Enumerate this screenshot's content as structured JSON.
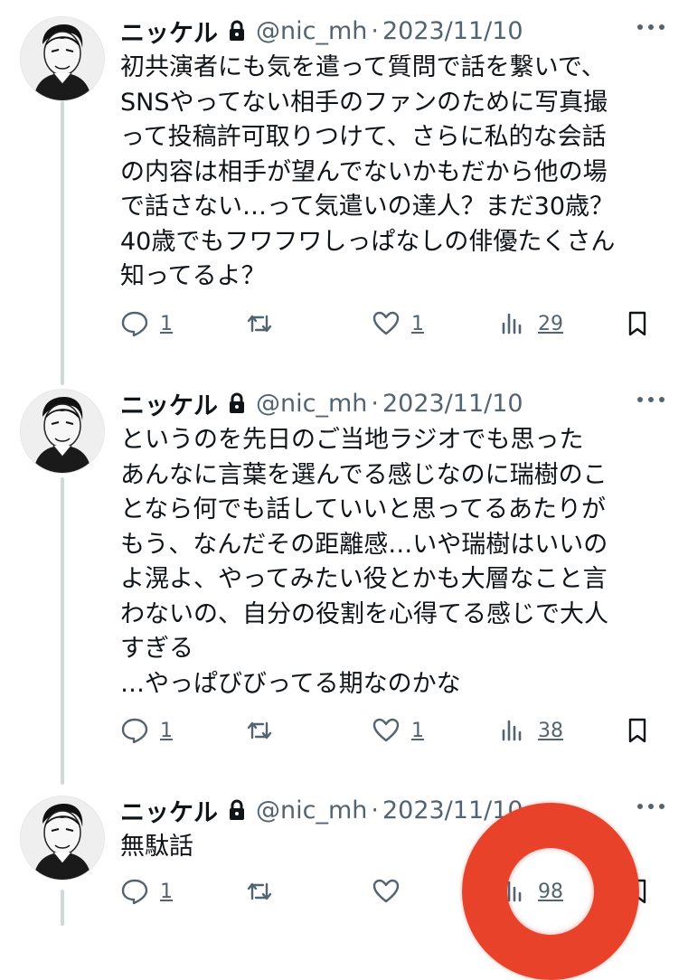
{
  "tweets": [
    {
      "author": {
        "name": "ニッケル",
        "handle": "@nic_mh"
      },
      "separator": "·",
      "date": "2023/11/10",
      "text": "初共演者にも気を遣って質問で話を繋いで、\nSNSやってない相手のファンのために写真撮\nって投稿許可取りつけて、さらに私的な会話\nの内容は相手が望んでないかもだから他の場\nで話さない…って気遣いの達人？まだ30歳？\n40歳でもフワフワしっぱなしの俳優たくさん\n知ってるよ？",
      "replies": "1",
      "retweets": "",
      "likes": "1",
      "views": "29"
    },
    {
      "author": {
        "name": "ニッケル",
        "handle": "@nic_mh"
      },
      "separator": "·",
      "date": "2023/11/10",
      "text": "というのを先日のご当地ラジオでも思った\nあんなに言葉を選んでる感じなのに瑞樹のこ\nとなら何でも話していいと思ってるあたりが\nもう、なんだその距離感…いや瑞樹はいいの\nよ滉よ、やってみたい役とかも大層なこと言\nわないの、自分の役割を心得てる感じで大人\nすぎる\n…やっぱびびってる期なのかな",
      "replies": "1",
      "retweets": "",
      "likes": "1",
      "views": "38"
    },
    {
      "author": {
        "name": "ニッケル",
        "handle": "@nic_mh"
      },
      "separator": "·",
      "date": "2023/11/10",
      "text": "無駄話",
      "replies": "1",
      "retweets": "",
      "likes": "",
      "views": "98"
    }
  ],
  "icons": {
    "reply": "speech-bubble-icon",
    "retweet": "retweet-arrows-icon",
    "like": "heart-icon",
    "views": "bar-chart-icon",
    "bookmark": "bookmark-icon",
    "more": "ellipsis-icon",
    "lock": "lock-icon"
  },
  "colors": {
    "text": "#0f1419",
    "muted": "#536471",
    "thread": "#cfd9de",
    "overlay": "#e8422a"
  }
}
